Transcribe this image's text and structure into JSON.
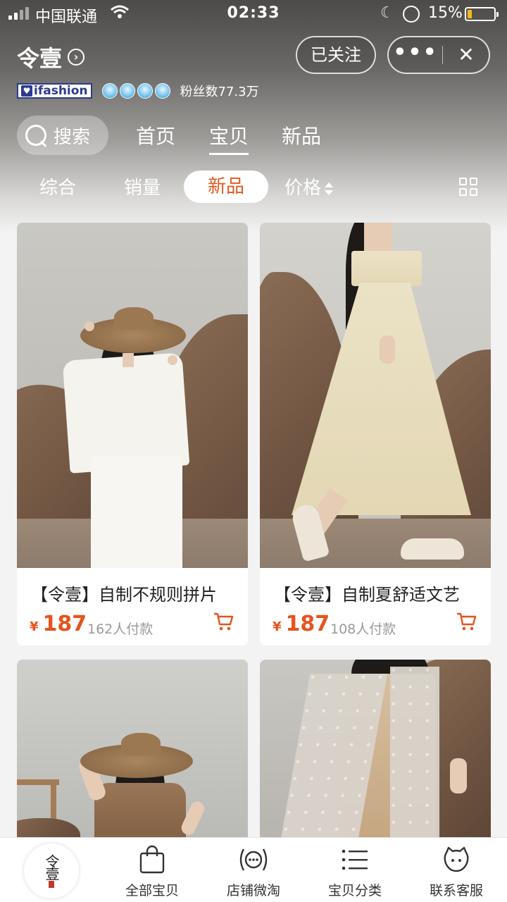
{
  "status_bar": {
    "carrier": "中国联通",
    "time": "02:33",
    "battery_percent": "15%",
    "battery_level": 0.15
  },
  "shop": {
    "name": "令壹",
    "follow_label": "已关注",
    "more_label": "•••",
    "close_label": "✕",
    "brand_badge": "ifashion",
    "fans": "粉丝数77.3万",
    "crown_count": 4
  },
  "nav": {
    "search_label": "搜索",
    "tabs": [
      {
        "label": "首页",
        "active": false
      },
      {
        "label": "宝贝",
        "active": true
      },
      {
        "label": "新品",
        "active": false
      }
    ]
  },
  "sort": {
    "options": [
      "综合",
      "销量",
      "新品",
      "价格"
    ],
    "active": "新品"
  },
  "products": [
    {
      "title": "【令壹】自制不规则拼片",
      "currency": "¥",
      "price": "187",
      "sold": "162人付款"
    },
    {
      "title": "【令壹】自制夏舒适文艺",
      "currency": "¥",
      "price": "187",
      "sold": "108人付款"
    },
    {
      "title": "",
      "currency": "",
      "price": "",
      "sold": ""
    },
    {
      "title": "",
      "currency": "",
      "price": "",
      "sold": ""
    }
  ],
  "tabbar": {
    "logo_text": "令壹",
    "items": [
      {
        "label": "全部宝贝",
        "icon": "shopping-bag-icon"
      },
      {
        "label": "店铺微淘",
        "icon": "broadcast-icon"
      },
      {
        "label": "宝贝分类",
        "icon": "list-icon"
      },
      {
        "label": "联系客服",
        "icon": "chat-face-icon"
      }
    ]
  },
  "colors": {
    "accent": "#e5541e",
    "badge_blue": "#2b3a8f"
  }
}
